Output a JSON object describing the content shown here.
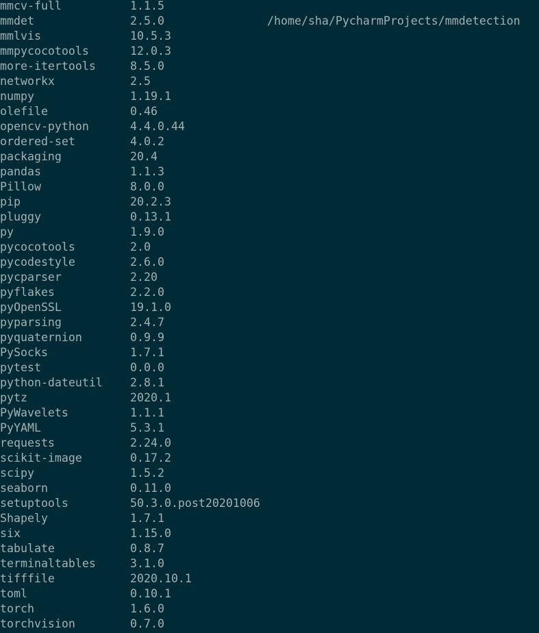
{
  "terminal": {
    "colors": {
      "background": "#002b36",
      "text": "#a3b1b1"
    },
    "packages": [
      {
        "name": "mmcv-full",
        "version": "1.1.5"
      },
      {
        "name": "mmdet",
        "version": "2.5.0",
        "location": "/home/sha/PycharmProjects/mmdetection"
      },
      {
        "name": "mmlvis",
        "version": "10.5.3"
      },
      {
        "name": "mmpycocotools",
        "version": "12.0.3"
      },
      {
        "name": "more-itertools",
        "version": "8.5.0"
      },
      {
        "name": "networkx",
        "version": "2.5"
      },
      {
        "name": "numpy",
        "version": "1.19.1"
      },
      {
        "name": "olefile",
        "version": "0.46"
      },
      {
        "name": "opencv-python",
        "version": "4.4.0.44"
      },
      {
        "name": "ordered-set",
        "version": "4.0.2"
      },
      {
        "name": "packaging",
        "version": "20.4"
      },
      {
        "name": "pandas",
        "version": "1.1.3"
      },
      {
        "name": "Pillow",
        "version": "8.0.0"
      },
      {
        "name": "pip",
        "version": "20.2.3"
      },
      {
        "name": "pluggy",
        "version": "0.13.1"
      },
      {
        "name": "py",
        "version": "1.9.0"
      },
      {
        "name": "pycocotools",
        "version": "2.0"
      },
      {
        "name": "pycodestyle",
        "version": "2.6.0"
      },
      {
        "name": "pycparser",
        "version": "2.20"
      },
      {
        "name": "pyflakes",
        "version": "2.2.0"
      },
      {
        "name": "pyOpenSSL",
        "version": "19.1.0"
      },
      {
        "name": "pyparsing",
        "version": "2.4.7"
      },
      {
        "name": "pyquaternion",
        "version": "0.9.9"
      },
      {
        "name": "PySocks",
        "version": "1.7.1"
      },
      {
        "name": "pytest",
        "version": "0.0.0"
      },
      {
        "name": "python-dateutil",
        "version": "2.8.1"
      },
      {
        "name": "pytz",
        "version": "2020.1"
      },
      {
        "name": "PyWavelets",
        "version": "1.1.1"
      },
      {
        "name": "PyYAML",
        "version": "5.3.1"
      },
      {
        "name": "requests",
        "version": "2.24.0"
      },
      {
        "name": "scikit-image",
        "version": "0.17.2"
      },
      {
        "name": "scipy",
        "version": "1.5.2"
      },
      {
        "name": "seaborn",
        "version": "0.11.0"
      },
      {
        "name": "setuptools",
        "version": "50.3.0.post20201006"
      },
      {
        "name": "Shapely",
        "version": "1.7.1"
      },
      {
        "name": "six",
        "version": "1.15.0"
      },
      {
        "name": "tabulate",
        "version": "0.8.7"
      },
      {
        "name": "terminaltables",
        "version": "3.1.0"
      },
      {
        "name": "tifffile",
        "version": "2020.10.1"
      },
      {
        "name": "toml",
        "version": "0.10.1"
      },
      {
        "name": "torch",
        "version": "1.6.0"
      },
      {
        "name": "torchvision",
        "version": "0.7.0"
      }
    ]
  }
}
